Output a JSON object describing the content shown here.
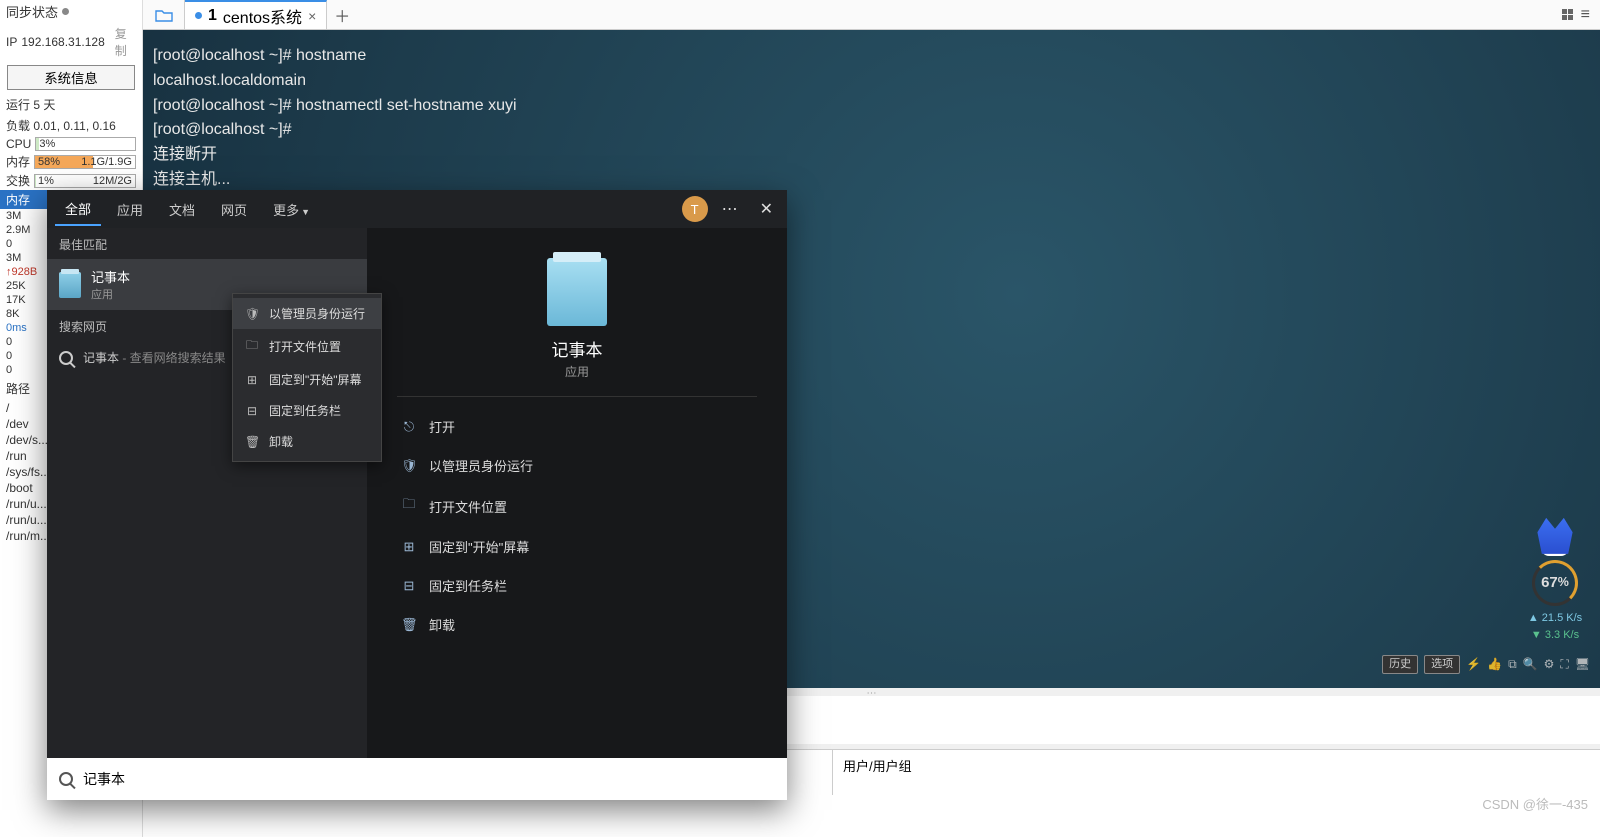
{
  "sidebar": {
    "sync_label": "同步状态",
    "ip_label": "IP",
    "ip_value": "192.168.31.128",
    "copy_label": "复制",
    "sysinfo_btn": "系统信息",
    "uptime": "运行 5 天",
    "load_label": "负载 0.01, 0.11, 0.16",
    "cpu_label": "CPU",
    "cpu_pct": "3%",
    "mem_label": "内存",
    "mem_pct": "58%",
    "mem_val": "1.1G/1.9G",
    "swap_label": "交换",
    "swap_pct": "1%",
    "swap_val": "12M/2G",
    "mem_section": "内存",
    "mem_ticks": [
      "3M",
      "2.9M",
      "0",
      "3M"
    ],
    "net_up": "↑928B",
    "net_ticks": [
      "25K",
      "17K",
      "8K"
    ],
    "ping": "0ms",
    "ping_ticks": [
      "0",
      "0",
      "0"
    ],
    "path_hdr": "路径",
    "paths": [
      "/",
      "/dev",
      "/dev/s...",
      "/run",
      "/sys/fs...",
      "/boot",
      "/run/u...",
      "/run/u...",
      "/run/m..."
    ]
  },
  "topbar": {
    "tab_num": "1",
    "tab_label": "centos系统"
  },
  "terminal": {
    "lines": [
      "[root@localhost ~]# hostname",
      "localhost.localdomain",
      "[root@localhost ~]# hostnamectl set-hostname xuyi",
      "[root@localhost ~]# ",
      "连接断开",
      "连接主机..."
    ],
    "footer": {
      "history": "历史",
      "options": "选项"
    },
    "widget": {
      "pct": "67",
      "unit": "%",
      "up": "▲ 21.5 K/s",
      "down": "▼ 3.3 K/s"
    }
  },
  "bottom": {
    "usergroup": "用户/用户组"
  },
  "search": {
    "tabs": {
      "all": "全部",
      "apps": "应用",
      "docs": "文档",
      "web": "网页",
      "more": "更多"
    },
    "avatar": "T",
    "section_best": "最佳匹配",
    "app_name": "记事本",
    "app_type": "应用",
    "section_web": "搜索网页",
    "web_text_a": "记事本",
    "web_text_b": " - 查看网络搜索结果",
    "big_name": "记事本",
    "big_type": "应用",
    "actions": [
      "打开",
      "以管理员身份运行",
      "打开文件位置",
      "固定到\"开始\"屏幕",
      "固定到任务栏",
      "卸载"
    ],
    "input_value": "记事本"
  },
  "ctx": {
    "items": [
      "以管理员身份运行",
      "打开文件位置",
      "固定到\"开始\"屏幕",
      "固定到任务栏",
      "卸载"
    ]
  },
  "watermark": "CSDN @徐一-435"
}
